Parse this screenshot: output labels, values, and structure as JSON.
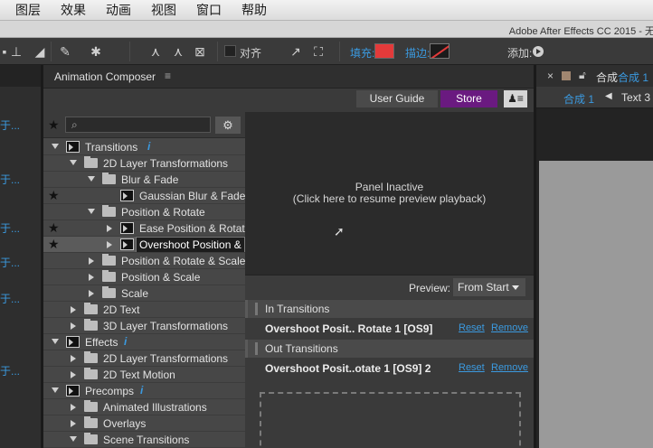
{
  "menubar": {
    "items": [
      "图层",
      "效果",
      "动画",
      "视图",
      "窗口",
      "帮助"
    ]
  },
  "titlebar": {
    "title": "Adobe After Effects CC 2015 - 无"
  },
  "toolbar": {
    "align_label": "对齐",
    "fill_label": "填充:",
    "stroke_label": "描边:",
    "add_label": "添加:",
    "fill_color": "#e33a3a"
  },
  "left_strip": {
    "links": [
      "于...",
      "于...",
      "于...",
      "于...",
      "于...",
      "于..."
    ]
  },
  "panel": {
    "title": "Animation Composer",
    "menu_icon": "≡",
    "user_guide": "User Guide",
    "store": "Store",
    "store_color": "#6a1a80"
  },
  "tree": {
    "rows": [
      {
        "label": "Transitions",
        "info": "i"
      },
      {
        "label": "2D Layer Transformations"
      },
      {
        "label": "Blur & Fade"
      },
      {
        "label": "Gaussian Blur & Fade"
      },
      {
        "label": "Position & Rotate"
      },
      {
        "label": "Ease Position & Rotate"
      },
      {
        "label": "Overshoot Position & Rotate"
      },
      {
        "label": "Position & Rotate & Scale"
      },
      {
        "label": "Position & Scale"
      },
      {
        "label": "Scale"
      },
      {
        "label": "2D Text"
      },
      {
        "label": "3D Layer Transformations"
      },
      {
        "label": "Effects",
        "info": "i"
      },
      {
        "label": "2D Layer Transformations"
      },
      {
        "label": "2D Text Motion"
      },
      {
        "label": "Precomps",
        "info": "i"
      },
      {
        "label": "Animated Illustrations"
      },
      {
        "label": "Overlays"
      },
      {
        "label": "Scene Transitions"
      }
    ]
  },
  "preview": {
    "line1": "Panel Inactive",
    "line2": "(Click here to resume preview playback)",
    "label": "Preview:",
    "mode": "From Start"
  },
  "in_transitions": {
    "title": "In Transitions",
    "item": "Overshoot Posit.. Rotate 1 [OS9]",
    "reset": "Reset",
    "remove": "Remove"
  },
  "out_transitions": {
    "title": "Out Transitions",
    "item": "Overshoot Posit..otate 1 [OS9] 2",
    "reset": "Reset",
    "remove": "Remove"
  },
  "right_panel": {
    "comp_label": "合成",
    "comp_name": "合成 1",
    "tab_comp": "合成 1",
    "tab_text": "Text 3"
  }
}
